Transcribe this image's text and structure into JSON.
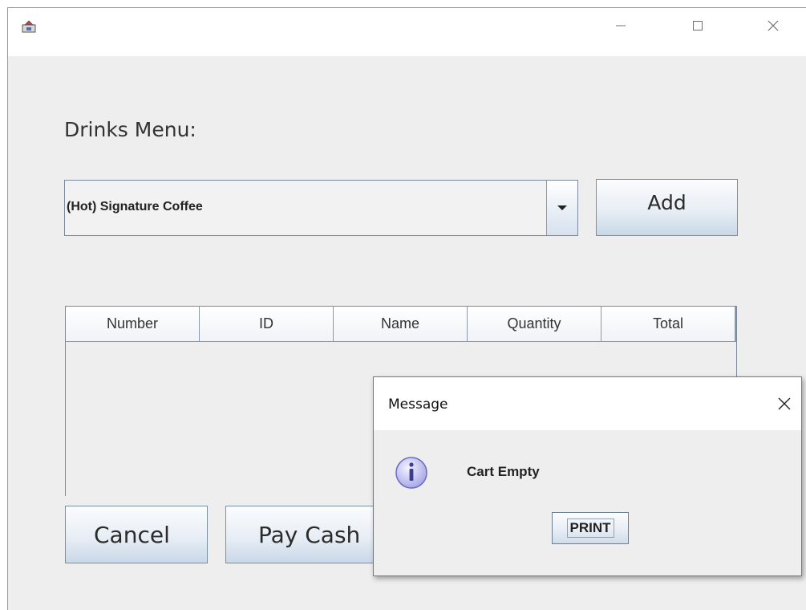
{
  "window": {
    "title": "",
    "icon": "java-app-icon",
    "controls": [
      "minimize-icon",
      "maximize-icon",
      "close-icon"
    ]
  },
  "menu": {
    "label": "Drinks Menu:",
    "selected_drink": "(Hot) Signature Coffee",
    "add_label": "Add"
  },
  "cart_table": {
    "columns": [
      "Number",
      "ID",
      "Name",
      "Quantity",
      "Total"
    ],
    "rows": []
  },
  "actions": {
    "cancel_label": "Cancel",
    "pay_cash_label": "Pay Cash"
  },
  "dialog": {
    "title": "Message",
    "message": "Cart Empty",
    "icon": "info-icon",
    "button_label": "PRINT"
  },
  "colors": {
    "window_bg": "#eeeeee",
    "titlebar_bg": "#ffffff",
    "button_gradient_bottom": "#c9d8e7",
    "border": "#7a8a9c",
    "info_icon": "#8f8fd6"
  }
}
